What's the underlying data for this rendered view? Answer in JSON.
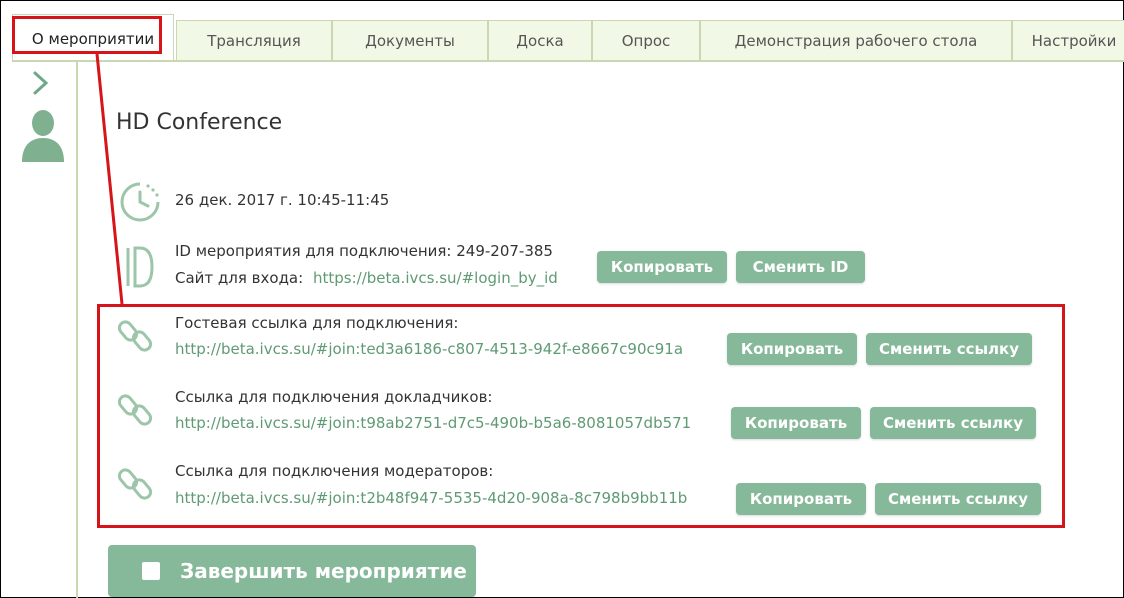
{
  "tabs": [
    {
      "label": "О мероприятии"
    },
    {
      "label": "Трансляция"
    },
    {
      "label": "Документы"
    },
    {
      "label": "Доска"
    },
    {
      "label": "Опрос"
    },
    {
      "label": "Демонстрация рабочего стола"
    },
    {
      "label": "Настройки"
    }
  ],
  "event": {
    "title": "HD Conference",
    "datetime": "26 дек. 2017 г. 10:45-11:45",
    "id_line": "ID мероприятия для подключения: 249-207-385",
    "site_label": "Сайт для входа:",
    "site_url": "https://beta.ivcs.su/#login_by_id"
  },
  "buttons": {
    "copy": "Копировать",
    "change_id": "Сменить ID",
    "change_link": "Сменить ссылку",
    "end_event": "Завершить мероприятие"
  },
  "links": [
    {
      "label": "Гостевая ссылка для подключения:",
      "url": "http://beta.ivcs.su/#join:ted3a6186-c807-4513-942f-e8667c90c91a"
    },
    {
      "label": "Ссылка для подключения докладчиков:",
      "url": "http://beta.ivcs.su/#join:t98ab2751-d7c5-490b-b5a6-8081057db571"
    },
    {
      "label": "Ссылка для подключения модераторов:",
      "url": "http://beta.ivcs.su/#join:t2b48f947-5535-4d20-908a-8c798b9bb11b"
    }
  ],
  "colors": {
    "accent": "#86b89a",
    "link": "#5f9a74",
    "highlight": "#d7141a"
  }
}
